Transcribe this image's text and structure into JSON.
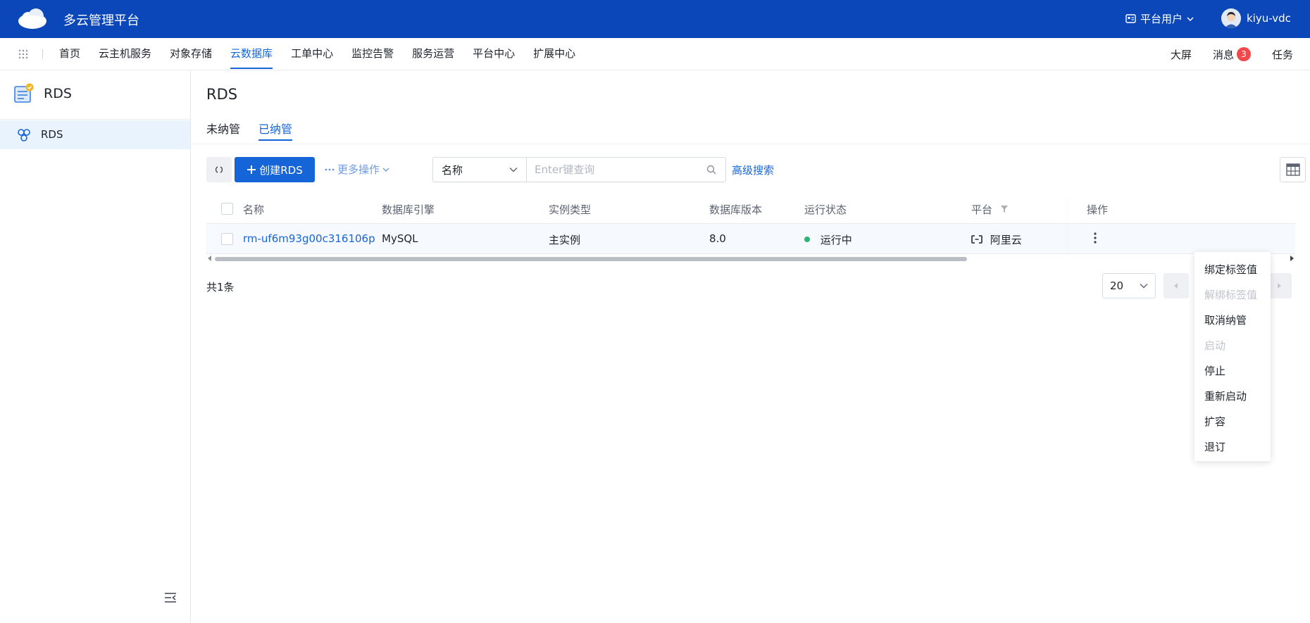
{
  "header": {
    "app_title": "多云管理平台",
    "platform_user_label": "平台用户",
    "username": "kiyu-vdc",
    "brand_color": "#0b47b8"
  },
  "nav": {
    "items": [
      {
        "label": "首页",
        "active": false
      },
      {
        "label": "云主机服务",
        "active": false
      },
      {
        "label": "对象存储",
        "active": false
      },
      {
        "label": "云数据库",
        "active": true
      },
      {
        "label": "工单中心",
        "active": false
      },
      {
        "label": "监控告警",
        "active": false
      },
      {
        "label": "服务运营",
        "active": false
      },
      {
        "label": "平台中心",
        "active": false
      },
      {
        "label": "扩展中心",
        "active": false
      }
    ],
    "big_screen": "大屏",
    "messages": "消息",
    "message_count": "3",
    "tasks": "任务"
  },
  "sidebar": {
    "title": "RDS",
    "items": [
      {
        "label": "RDS",
        "active": true
      }
    ]
  },
  "main": {
    "page_title": "RDS",
    "tabs": [
      {
        "label": "未纳管",
        "active": false
      },
      {
        "label": "已纳管",
        "active": true
      }
    ],
    "toolbar": {
      "create_label": "创建RDS",
      "more_label": "更多操作",
      "filter_field": "名称",
      "search_placeholder": "Enter键查询",
      "advanced_search": "高级搜索"
    },
    "table": {
      "columns": [
        "名称",
        "数据库引擎",
        "实例类型",
        "数据库版本",
        "运行状态",
        "平台",
        "操作"
      ],
      "rows": [
        {
          "name": "rm-uf6m93g00c316106p",
          "engine": "MySQL",
          "instance_type": "主实例",
          "version": "8.0",
          "status": "运行中",
          "platform": "阿里云"
        }
      ]
    },
    "pagination": {
      "total": "共1条",
      "page_size": "20"
    }
  },
  "action_menu": {
    "items": [
      {
        "label": "绑定标签值",
        "disabled": false
      },
      {
        "label": "解绑标签值",
        "disabled": true
      },
      {
        "label": "取消纳管",
        "disabled": false
      },
      {
        "label": "启动",
        "disabled": true
      },
      {
        "label": "停止",
        "disabled": false
      },
      {
        "label": "重新启动",
        "disabled": false
      },
      {
        "label": "扩容",
        "disabled": false
      },
      {
        "label": "退订",
        "disabled": false
      }
    ]
  }
}
